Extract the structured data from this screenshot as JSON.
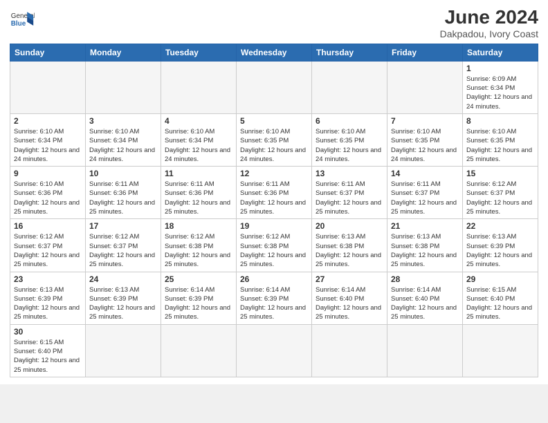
{
  "header": {
    "logo_general": "General",
    "logo_blue": "Blue",
    "month_title": "June 2024",
    "location": "Dakpadou, Ivory Coast"
  },
  "days_of_week": [
    "Sunday",
    "Monday",
    "Tuesday",
    "Wednesday",
    "Thursday",
    "Friday",
    "Saturday"
  ],
  "weeks": [
    [
      {
        "day": "",
        "info": ""
      },
      {
        "day": "",
        "info": ""
      },
      {
        "day": "",
        "info": ""
      },
      {
        "day": "",
        "info": ""
      },
      {
        "day": "",
        "info": ""
      },
      {
        "day": "",
        "info": ""
      },
      {
        "day": "1",
        "info": "Sunrise: 6:09 AM\nSunset: 6:34 PM\nDaylight: 12 hours and 24 minutes."
      }
    ],
    [
      {
        "day": "2",
        "info": "Sunrise: 6:10 AM\nSunset: 6:34 PM\nDaylight: 12 hours and 24 minutes."
      },
      {
        "day": "3",
        "info": "Sunrise: 6:10 AM\nSunset: 6:34 PM\nDaylight: 12 hours and 24 minutes."
      },
      {
        "day": "4",
        "info": "Sunrise: 6:10 AM\nSunset: 6:34 PM\nDaylight: 12 hours and 24 minutes."
      },
      {
        "day": "5",
        "info": "Sunrise: 6:10 AM\nSunset: 6:35 PM\nDaylight: 12 hours and 24 minutes."
      },
      {
        "day": "6",
        "info": "Sunrise: 6:10 AM\nSunset: 6:35 PM\nDaylight: 12 hours and 24 minutes."
      },
      {
        "day": "7",
        "info": "Sunrise: 6:10 AM\nSunset: 6:35 PM\nDaylight: 12 hours and 24 minutes."
      },
      {
        "day": "8",
        "info": "Sunrise: 6:10 AM\nSunset: 6:35 PM\nDaylight: 12 hours and 25 minutes."
      }
    ],
    [
      {
        "day": "9",
        "info": "Sunrise: 6:10 AM\nSunset: 6:36 PM\nDaylight: 12 hours and 25 minutes."
      },
      {
        "day": "10",
        "info": "Sunrise: 6:11 AM\nSunset: 6:36 PM\nDaylight: 12 hours and 25 minutes."
      },
      {
        "day": "11",
        "info": "Sunrise: 6:11 AM\nSunset: 6:36 PM\nDaylight: 12 hours and 25 minutes."
      },
      {
        "day": "12",
        "info": "Sunrise: 6:11 AM\nSunset: 6:36 PM\nDaylight: 12 hours and 25 minutes."
      },
      {
        "day": "13",
        "info": "Sunrise: 6:11 AM\nSunset: 6:37 PM\nDaylight: 12 hours and 25 minutes."
      },
      {
        "day": "14",
        "info": "Sunrise: 6:11 AM\nSunset: 6:37 PM\nDaylight: 12 hours and 25 minutes."
      },
      {
        "day": "15",
        "info": "Sunrise: 6:12 AM\nSunset: 6:37 PM\nDaylight: 12 hours and 25 minutes."
      }
    ],
    [
      {
        "day": "16",
        "info": "Sunrise: 6:12 AM\nSunset: 6:37 PM\nDaylight: 12 hours and 25 minutes."
      },
      {
        "day": "17",
        "info": "Sunrise: 6:12 AM\nSunset: 6:37 PM\nDaylight: 12 hours and 25 minutes."
      },
      {
        "day": "18",
        "info": "Sunrise: 6:12 AM\nSunset: 6:38 PM\nDaylight: 12 hours and 25 minutes."
      },
      {
        "day": "19",
        "info": "Sunrise: 6:12 AM\nSunset: 6:38 PM\nDaylight: 12 hours and 25 minutes."
      },
      {
        "day": "20",
        "info": "Sunrise: 6:13 AM\nSunset: 6:38 PM\nDaylight: 12 hours and 25 minutes."
      },
      {
        "day": "21",
        "info": "Sunrise: 6:13 AM\nSunset: 6:38 PM\nDaylight: 12 hours and 25 minutes."
      },
      {
        "day": "22",
        "info": "Sunrise: 6:13 AM\nSunset: 6:39 PM\nDaylight: 12 hours and 25 minutes."
      }
    ],
    [
      {
        "day": "23",
        "info": "Sunrise: 6:13 AM\nSunset: 6:39 PM\nDaylight: 12 hours and 25 minutes."
      },
      {
        "day": "24",
        "info": "Sunrise: 6:13 AM\nSunset: 6:39 PM\nDaylight: 12 hours and 25 minutes."
      },
      {
        "day": "25",
        "info": "Sunrise: 6:14 AM\nSunset: 6:39 PM\nDaylight: 12 hours and 25 minutes."
      },
      {
        "day": "26",
        "info": "Sunrise: 6:14 AM\nSunset: 6:39 PM\nDaylight: 12 hours and 25 minutes."
      },
      {
        "day": "27",
        "info": "Sunrise: 6:14 AM\nSunset: 6:40 PM\nDaylight: 12 hours and 25 minutes."
      },
      {
        "day": "28",
        "info": "Sunrise: 6:14 AM\nSunset: 6:40 PM\nDaylight: 12 hours and 25 minutes."
      },
      {
        "day": "29",
        "info": "Sunrise: 6:15 AM\nSunset: 6:40 PM\nDaylight: 12 hours and 25 minutes."
      }
    ],
    [
      {
        "day": "30",
        "info": "Sunrise: 6:15 AM\nSunset: 6:40 PM\nDaylight: 12 hours and 25 minutes."
      },
      {
        "day": "",
        "info": ""
      },
      {
        "day": "",
        "info": ""
      },
      {
        "day": "",
        "info": ""
      },
      {
        "day": "",
        "info": ""
      },
      {
        "day": "",
        "info": ""
      },
      {
        "day": "",
        "info": ""
      }
    ]
  ]
}
